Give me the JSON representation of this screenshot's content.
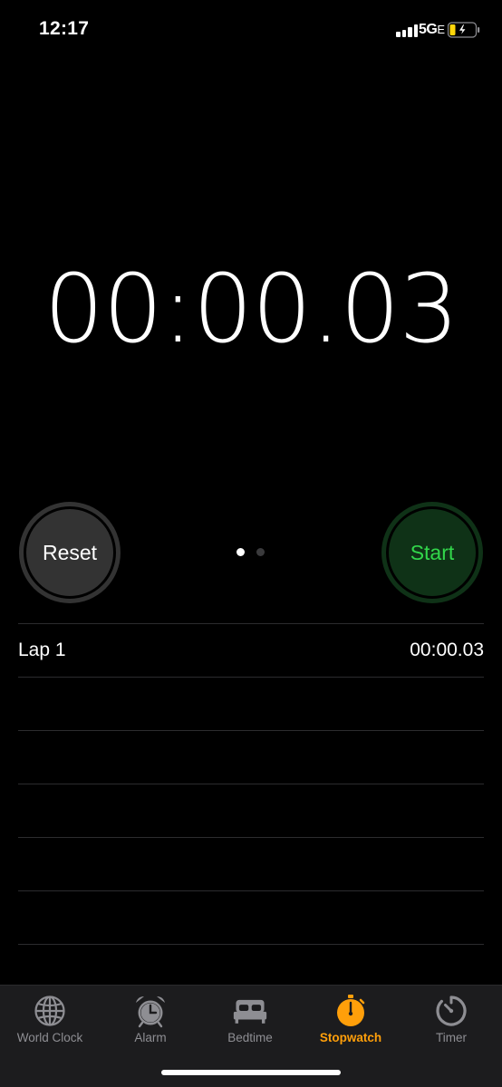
{
  "status_bar": {
    "time": "12:17",
    "network": "5G",
    "network_suffix": "E",
    "battery_color": "#ffd60a"
  },
  "stopwatch": {
    "display": "00:00.03",
    "reset_label": "Reset",
    "start_label": "Start",
    "page_count": 2,
    "active_page": 1
  },
  "laps": [
    {
      "label": "Lap 1",
      "time": "00:00.03"
    }
  ],
  "tab_bar": {
    "tabs": [
      {
        "label": "World Clock",
        "icon": "globe-icon"
      },
      {
        "label": "Alarm",
        "icon": "alarm-clock-icon"
      },
      {
        "label": "Bedtime",
        "icon": "bed-icon"
      },
      {
        "label": "Stopwatch",
        "icon": "stopwatch-icon"
      },
      {
        "label": "Timer",
        "icon": "timer-icon"
      }
    ],
    "active_index": 3,
    "active_color": "#ff9f0a",
    "inactive_color": "#8e8e93"
  },
  "colors": {
    "background": "#000000",
    "start_green": "#32d74b",
    "reset_gray": "#333333"
  }
}
